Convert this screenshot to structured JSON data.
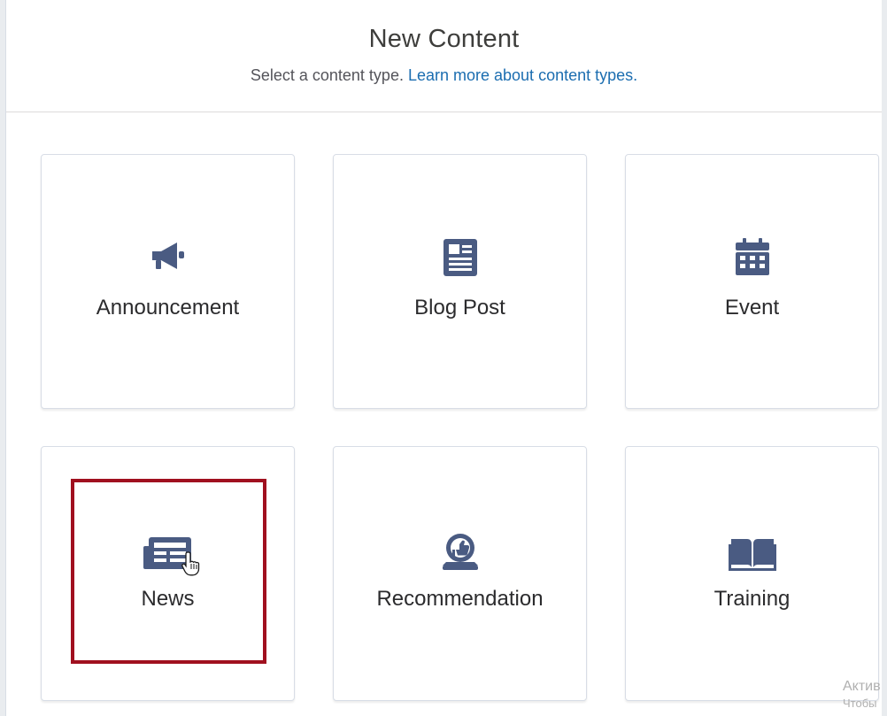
{
  "modal": {
    "title": "New Content",
    "subtitle_static": "Select a content type.",
    "subtitle_link": "Learn more about content types."
  },
  "tiles": [
    {
      "label": "Announcement",
      "icon": "megaphone-icon"
    },
    {
      "label": "Blog Post",
      "icon": "article-icon"
    },
    {
      "label": "Event",
      "icon": "calendar-icon"
    },
    {
      "label": "News",
      "icon": "news-icon"
    },
    {
      "label": "Recommendation",
      "icon": "recommendation-icon"
    },
    {
      "label": "Training",
      "icon": "open-book-icon"
    }
  ],
  "highlighted_tile": "News",
  "colors": {
    "icon": "#4a5b82",
    "link": "#1b6db0",
    "highlight": "#a0101f"
  },
  "watermark": {
    "line1": "Актив",
    "line2": "Чтобы"
  }
}
